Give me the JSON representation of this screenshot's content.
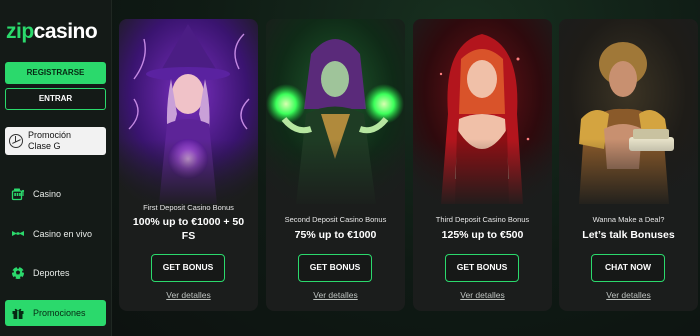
{
  "brand": {
    "logo_zip": "zip",
    "logo_casino": "casino",
    "accent": "#2bd96c"
  },
  "sidebar": {
    "register_label": "REGISTRARSE",
    "login_label": "ENTRAR",
    "promo_card": {
      "line1": "Promoción",
      "line2": "Clase G",
      "icon": "mercedes-icon"
    },
    "items": [
      {
        "label": "Casino",
        "icon": "slot-machine-icon",
        "active": false
      },
      {
        "label": "Casino en vivo",
        "icon": "ticket-icon",
        "active": false
      },
      {
        "label": "Deportes",
        "icon": "soccer-ball-icon",
        "active": false
      },
      {
        "label": "Promociones",
        "icon": "gift-icon",
        "active": true
      }
    ]
  },
  "cards": [
    {
      "art": "purple-witch-illustration",
      "subtitle": "First Deposit Casino Bonus",
      "headline_line1": "100% up to €1000 + 50",
      "headline_line2": "FS",
      "cta": "GET BONUS",
      "more": "Ver detalles"
    },
    {
      "art": "green-sorceress-illustration",
      "subtitle": "Second Deposit Casino Bonus",
      "headline_line1": "75% up to €1000",
      "headline_line2": "",
      "cta": "GET BONUS",
      "more": "Ver detalles"
    },
    {
      "art": "red-hood-illustration",
      "subtitle": "Third Deposit Casino Bonus",
      "headline_line1": "125% up to €500",
      "headline_line2": "",
      "cta": "GET BONUS",
      "more": "Ver detalles"
    },
    {
      "art": "golden-warrior-illustration",
      "subtitle": "Wanna Make a Deal?",
      "headline_line1": "Let’s talk Bonuses",
      "headline_line2": "",
      "cta": "CHAT NOW",
      "more": "Ver detalles"
    }
  ]
}
